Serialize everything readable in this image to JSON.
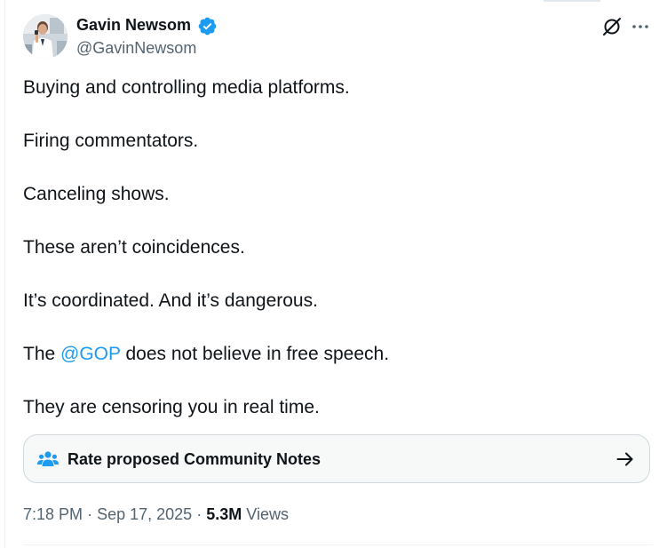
{
  "author": {
    "name": "Gavin Newsom",
    "handle": "@GavinNewsom",
    "verified": true,
    "avatar_icon": "profile-photo",
    "verified_icon": "verified-badge-icon"
  },
  "header_actions": {
    "grok_icon": "grok-icon",
    "more_icon": "more-icon"
  },
  "tweet": {
    "lines": [
      "Buying and controlling media platforms.",
      "Firing commentators.",
      "Canceling shows.",
      "These aren’t coincidences.",
      "It’s coordinated. And it’s dangerous."
    ],
    "line6_before": "The ",
    "line6_mention": "@GOP",
    "line6_after": " does not believe in free speech.",
    "line7": "They are censoring you in real time."
  },
  "community_notes": {
    "label": "Rate proposed Community Notes",
    "icon": "people-icon",
    "arrow_icon": "arrow-right-icon"
  },
  "meta": {
    "time": "7:18 PM",
    "separator": "·",
    "date": "Sep 17, 2025",
    "views_count": "5.3M",
    "views_label": "Views"
  },
  "colors": {
    "text": "#0f1419",
    "secondary": "#536471",
    "accent": "#1d9bf0",
    "border": "#cfd9de"
  }
}
